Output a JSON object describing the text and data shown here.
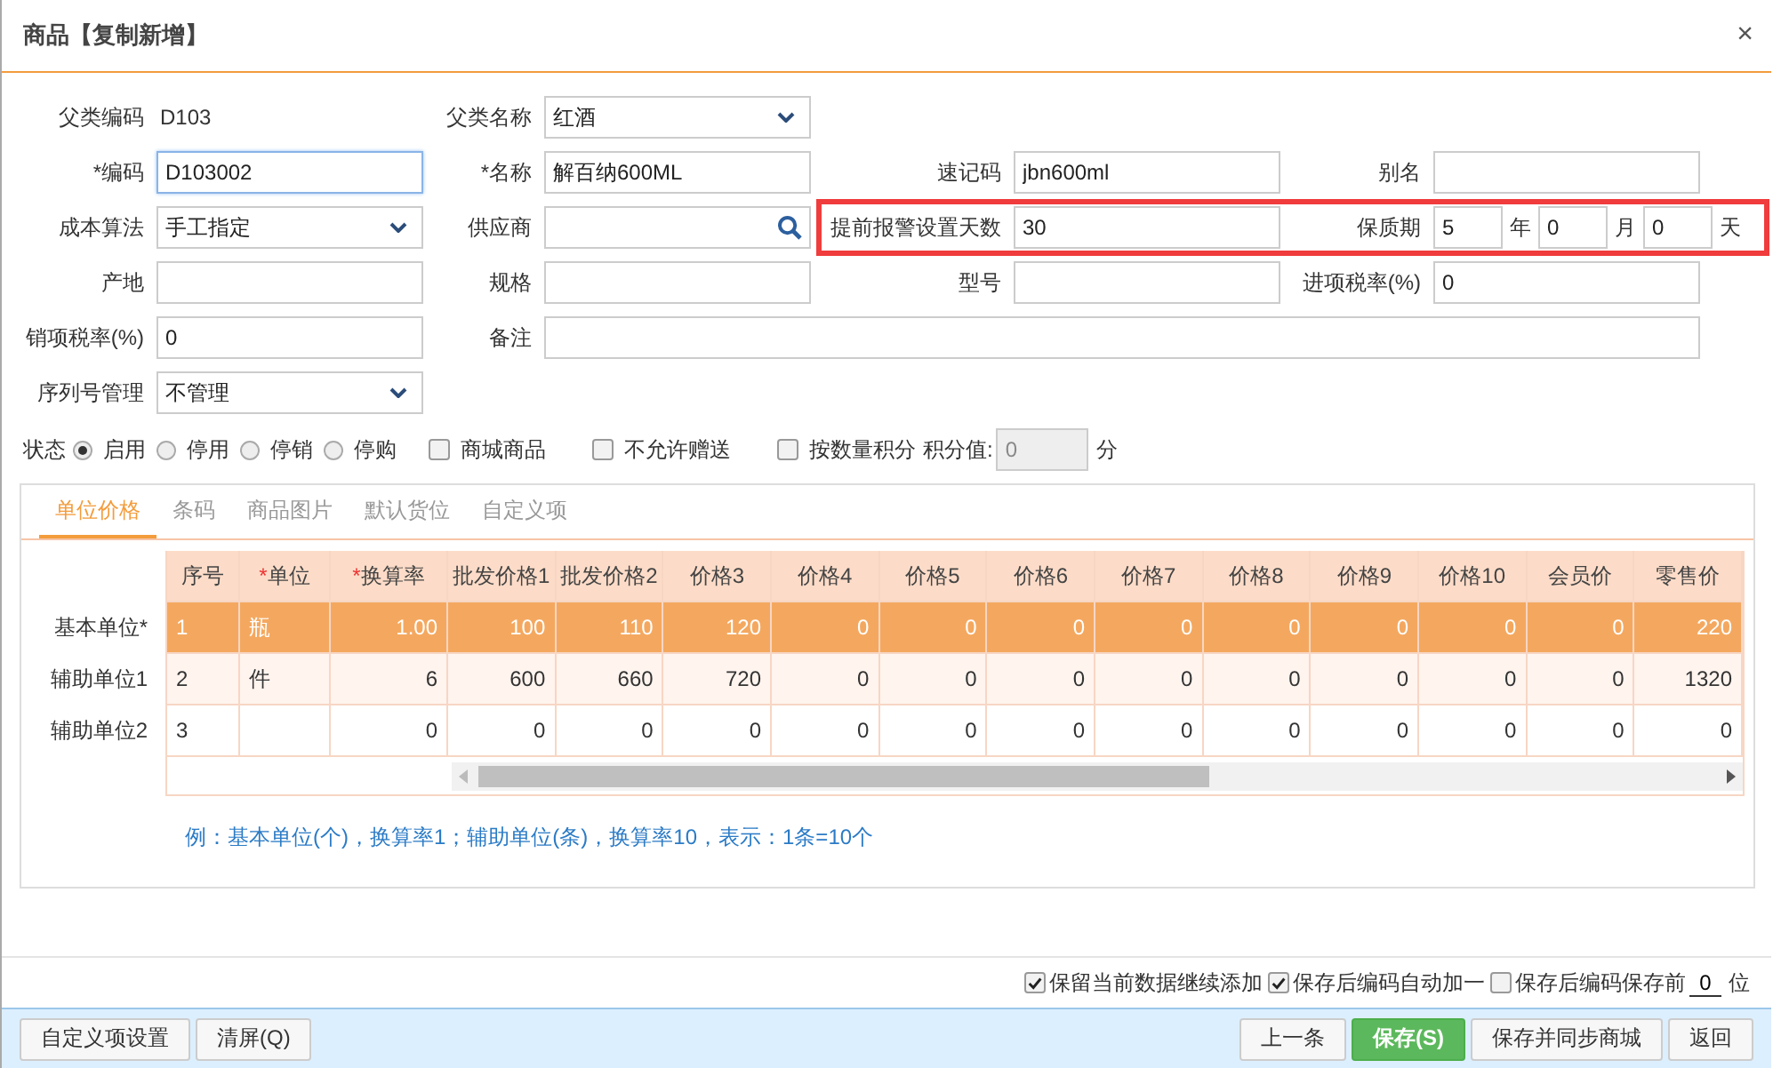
{
  "dialog": {
    "title": "商品【复制新增】",
    "close": "×"
  },
  "form": {
    "rows": [
      [
        {
          "label": "父类编码",
          "kind": "static",
          "value": "D103"
        },
        {
          "label": "父类名称",
          "kind": "select",
          "value": "红酒"
        }
      ],
      [
        {
          "label": "*编码",
          "kind": "text",
          "value": "D103002",
          "focused": true
        },
        {
          "label": "*名称",
          "kind": "text",
          "value": "解百纳600ML"
        },
        {
          "label": "速记码",
          "kind": "text",
          "value": "jbn600ml"
        },
        {
          "label": "别名",
          "kind": "text"
        }
      ],
      [
        {
          "label": "成本算法",
          "kind": "select",
          "value": "手工指定"
        },
        {
          "label": "供应商",
          "kind": "search"
        },
        {
          "label": "提前报警设置天数",
          "kind": "text",
          "value": "30",
          "highlighted": true
        },
        {
          "label": "保质期",
          "kind": "duration",
          "highlighted": true,
          "parts": [
            {
              "value": "5",
              "unit": "年"
            },
            {
              "value": "0",
              "unit": "月"
            },
            {
              "value": "0",
              "unit": "天"
            }
          ]
        }
      ],
      [
        {
          "label": "产地",
          "kind": "text"
        },
        {
          "label": "规格",
          "kind": "text"
        },
        {
          "label": "型号",
          "kind": "text"
        },
        {
          "label": "进项税率(%)",
          "kind": "text",
          "value": "0"
        }
      ],
      [
        {
          "label": "销项税率(%)",
          "kind": "text",
          "value": "0"
        },
        {
          "label": "备注",
          "kind": "wide"
        }
      ],
      [
        {
          "label": "序列号管理",
          "kind": "select",
          "value": "不管理"
        }
      ]
    ]
  },
  "status": {
    "label": "状态",
    "options": [
      {
        "label": "启用",
        "selected": true
      },
      {
        "label": "停用",
        "selected": false
      },
      {
        "label": "停销",
        "selected": false
      },
      {
        "label": "停购",
        "selected": false
      }
    ]
  },
  "flags": [
    {
      "label": "商城商品",
      "checked": false
    },
    {
      "label": "不允许赠送",
      "checked": false
    },
    {
      "label": "按数量积分",
      "checked": false
    }
  ],
  "points": {
    "label": "积分值:",
    "value": "0",
    "unit": "分",
    "disabled": true
  },
  "tabs": [
    {
      "label": "单位价格",
      "selected": true
    },
    {
      "label": "条码",
      "selected": false
    },
    {
      "label": "商品图片",
      "selected": false
    },
    {
      "label": "默认货位",
      "selected": false
    },
    {
      "label": "自定义项",
      "selected": false
    }
  ],
  "table": {
    "columns": [
      {
        "label": "序号"
      },
      {
        "mark": "*",
        "label": "单位"
      },
      {
        "mark": "*",
        "label": "换算率"
      },
      {
        "label": "批发价格1"
      },
      {
        "label": "批发价格2"
      },
      {
        "label": "价格3"
      },
      {
        "label": "价格4"
      },
      {
        "label": "价格5"
      },
      {
        "label": "价格6"
      },
      {
        "label": "价格7"
      },
      {
        "label": "价格8"
      },
      {
        "label": "价格9"
      },
      {
        "label": "价格10"
      },
      {
        "label": "会员价"
      },
      {
        "label": "零售价"
      }
    ],
    "rows": [
      {
        "row_label": "基本单位*",
        "selected": true,
        "cells": [
          "1",
          "瓶",
          "1.00",
          "100",
          "110",
          "120",
          "0",
          "0",
          "0",
          "0",
          "0",
          "0",
          "0",
          "0",
          "220"
        ]
      },
      {
        "row_label": "辅助单位1",
        "selected": false,
        "cells": [
          "2",
          "件",
          "6",
          "600",
          "660",
          "720",
          "0",
          "0",
          "0",
          "0",
          "0",
          "0",
          "0",
          "0",
          "1320"
        ]
      },
      {
        "row_label": "辅助单位2",
        "selected": false,
        "cells": [
          "3",
          "",
          "0",
          "0",
          "0",
          "0",
          "0",
          "0",
          "0",
          "0",
          "0",
          "0",
          "0",
          "0",
          "0"
        ]
      }
    ]
  },
  "hint": "例：基本单位(个)，换算率1；辅助单位(条)，换算率10，表示：1条=10个",
  "options": [
    {
      "label": "保留当前数据继续添加",
      "checked": true
    },
    {
      "label": "保存后编码自动加一",
      "checked": true
    },
    {
      "label": "保存后编码保存前",
      "checked": false
    }
  ],
  "keep_digits": {
    "value": "0",
    "unit": "位"
  },
  "buttons_left": [
    {
      "label": "自定义项设置",
      "kind": "default"
    },
    {
      "label": "清屏(Q)",
      "kind": "default"
    }
  ],
  "buttons_right": [
    {
      "label": "上一条",
      "kind": "default"
    },
    {
      "label": "保存(S)",
      "kind": "primary"
    },
    {
      "label": "保存并同步商城",
      "kind": "default"
    },
    {
      "label": "返回",
      "kind": "default"
    }
  ]
}
